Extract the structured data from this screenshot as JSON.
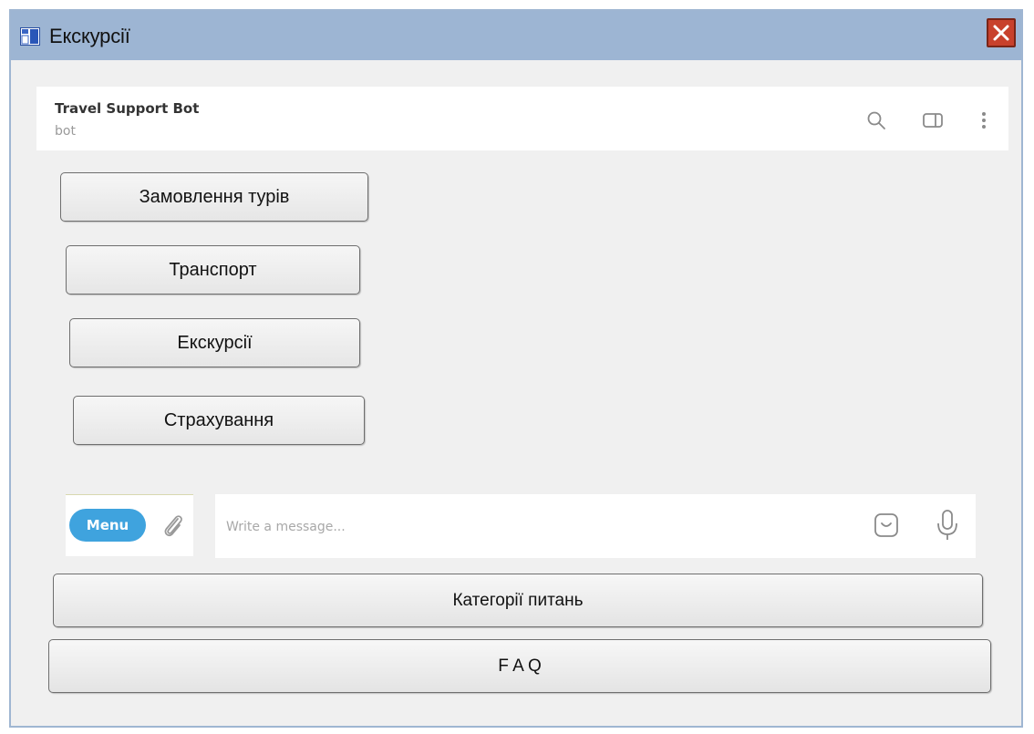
{
  "window": {
    "title": "Екскурсії"
  },
  "chat": {
    "bot_name": "Travel Support Bot",
    "bot_status": "bot"
  },
  "keyboard": {
    "buttons": [
      "Замовлення турів",
      "Транспорт",
      "Екскурсії",
      "Страхування"
    ]
  },
  "composer": {
    "menu_label": "Menu",
    "placeholder": "Write a message..."
  },
  "bottom_buttons": [
    "Категорії питань",
    "F A Q"
  ],
  "colors": {
    "titlebar": "#9db5d3",
    "close": "#c8412c",
    "menu_pill": "#3fa3de",
    "background": "#f0f0f0"
  }
}
